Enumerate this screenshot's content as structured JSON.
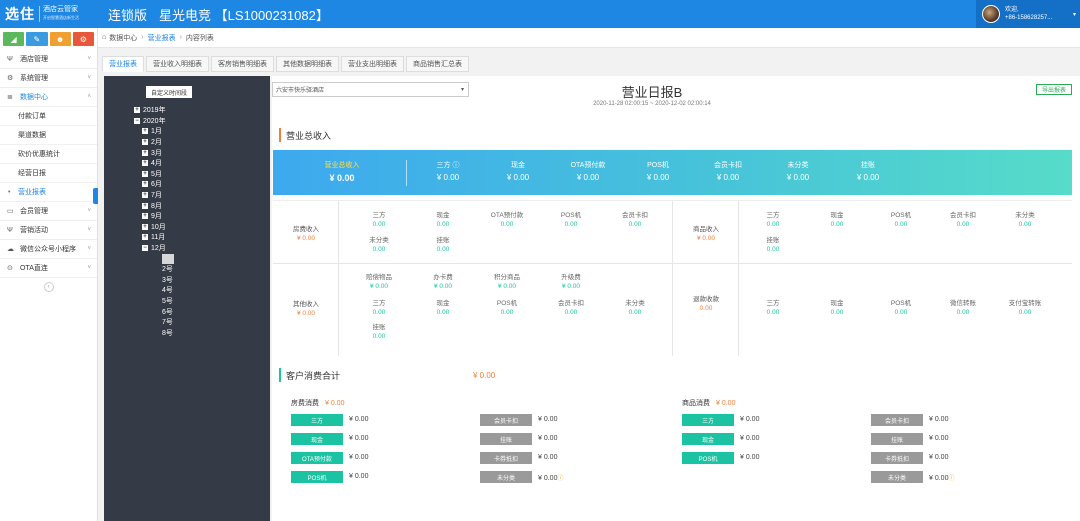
{
  "header": {
    "logo_main": "选住",
    "logo_sub1": "酒店云管家",
    "logo_sub2": "开启智慧酒店新生活",
    "edition": "连锁版",
    "store_name": "星光电竞 【LS1000231082】",
    "welcome": "欢迎,",
    "phone": "+86-158628257..."
  },
  "quick_buttons": [
    {
      "icon": "chart-icon",
      "color": "#5cb85c",
      "glyph": "◢"
    },
    {
      "icon": "pencil-icon",
      "color": "#3b9be0",
      "glyph": "✎"
    },
    {
      "icon": "users-icon",
      "color": "#f0a030",
      "glyph": "☻"
    },
    {
      "icon": "gear-icon",
      "color": "#e8573c",
      "glyph": "⚙"
    }
  ],
  "sidebar": {
    "items": [
      {
        "label": "酒店管理",
        "glyph": "Ψ"
      },
      {
        "label": "系统管理",
        "glyph": "⚙"
      },
      {
        "label": "数据中心",
        "glyph": "≣"
      }
    ],
    "sub_items": [
      {
        "label": "付款订单"
      },
      {
        "label": "渠道数据"
      },
      {
        "label": "砍价优惠统计"
      },
      {
        "label": "经营日报"
      },
      {
        "label": "营业报表"
      }
    ],
    "items_after": [
      {
        "label": "会员管理",
        "glyph": "▭"
      },
      {
        "label": "营销活动",
        "glyph": "Ψ"
      },
      {
        "label": "微信公众号小程序",
        "glyph": "☁"
      },
      {
        "label": "OTA直连",
        "glyph": "⊙"
      }
    ]
  },
  "breadcrumb": {
    "home": "数据中心",
    "section": "营业报表",
    "page": "内容列表"
  },
  "tabs": [
    "营业报表",
    "营业收入明细表",
    "客房销售明细表",
    "其他数据明细表",
    "营业支出明细表",
    "商品销售汇总表"
  ],
  "tree": {
    "button": "自定义时间段",
    "nodes": [
      {
        "label": "2019年",
        "box": "+",
        "level": 1
      },
      {
        "label": "2020年",
        "box": "−",
        "level": 1
      },
      {
        "label": "1月",
        "box": "+",
        "level": 2
      },
      {
        "label": "2月",
        "box": "+",
        "level": 2
      },
      {
        "label": "3月",
        "box": "+",
        "level": 2
      },
      {
        "label": "4月",
        "box": "+",
        "level": 2
      },
      {
        "label": "5月",
        "box": "+",
        "level": 2
      },
      {
        "label": "6月",
        "box": "+",
        "level": 2
      },
      {
        "label": "7月",
        "box": "+",
        "level": 2
      },
      {
        "label": "8月",
        "box": "+",
        "level": 2
      },
      {
        "label": "9月",
        "box": "+",
        "level": 2
      },
      {
        "label": "10月",
        "box": "+",
        "level": 2
      },
      {
        "label": "11月",
        "box": "+",
        "level": 2
      },
      {
        "label": "12月",
        "box": "−",
        "level": 2
      },
      {
        "label": "",
        "box": "",
        "level": 3,
        "selected": true
      },
      {
        "label": "2号",
        "box": "",
        "level": 3
      },
      {
        "label": "3号",
        "box": "",
        "level": 3
      },
      {
        "label": "4号",
        "box": "",
        "level": 3
      },
      {
        "label": "5号",
        "box": "",
        "level": 3
      },
      {
        "label": "6号",
        "box": "",
        "level": 3
      },
      {
        "label": "7号",
        "box": "",
        "level": 3
      },
      {
        "label": "8号",
        "box": "",
        "level": 3
      }
    ]
  },
  "report": {
    "store_select": "六安市快乐驿酒店",
    "title": "营业日报B",
    "range": "2020-11-28 02:00:15 ~ 2020-12-02 02:00:14",
    "export": "导出报表"
  },
  "revenue": {
    "section_title": "营业总收入",
    "summary": [
      {
        "label": "营业总收入",
        "value": "¥ 0.00"
      },
      {
        "label": "三方 ⓘ",
        "value": "¥ 0.00"
      },
      {
        "label": "现金",
        "value": "¥ 0.00"
      },
      {
        "label": "OTA预付款",
        "value": "¥ 0.00"
      },
      {
        "label": "POS机",
        "value": "¥ 0.00"
      },
      {
        "label": "会员卡扣",
        "value": "¥ 0.00"
      },
      {
        "label": "未分类",
        "value": "¥ 0.00"
      },
      {
        "label": "挂账",
        "value": "¥ 0.00"
      }
    ],
    "room": {
      "label": "房费收入",
      "amount": "¥ 0.00",
      "cells": [
        {
          "label": "三方",
          "value": "0.00"
        },
        {
          "label": "现金",
          "value": "0.00"
        },
        {
          "label": "OTA预付款",
          "value": "0.00"
        },
        {
          "label": "POS机",
          "value": "0.00"
        },
        {
          "label": "会员卡扣",
          "value": "0.00"
        },
        {
          "label": "未分类",
          "value": "0.00"
        },
        {
          "label": "挂账",
          "value": "0.00"
        }
      ]
    },
    "goods": {
      "label": "商品收入",
      "amount": "¥ 0.00",
      "cells": [
        {
          "label": "三方",
          "value": "0.00"
        },
        {
          "label": "现金",
          "value": "0.00"
        },
        {
          "label": "POS机",
          "value": "0.00"
        },
        {
          "label": "会员卡扣",
          "value": "0.00"
        },
        {
          "label": "未分类",
          "value": "0.00"
        },
        {
          "label": "挂账",
          "value": "0.00"
        }
      ]
    },
    "other": {
      "label": "其他收入",
      "amount": "¥ 0.00",
      "top": [
        {
          "label": "赔偿物品",
          "value": "¥ 0.00"
        },
        {
          "label": "办卡费",
          "value": "¥ 0.00"
        },
        {
          "label": "积分商品",
          "value": "¥ 0.00"
        },
        {
          "label": "升级费",
          "value": "¥ 0.00"
        }
      ],
      "cells": [
        {
          "label": "三方",
          "value": "0.00"
        },
        {
          "label": "现金",
          "value": "0.00"
        },
        {
          "label": "POS机",
          "value": "0.00"
        },
        {
          "label": "会员卡扣",
          "value": "0.00"
        },
        {
          "label": "未分类",
          "value": "0.00"
        },
        {
          "label": "挂账",
          "value": "0.00"
        }
      ]
    },
    "refund": {
      "label": "退款收款",
      "amount": "0.00",
      "cells": [
        {
          "label": "三方",
          "value": "0.00"
        },
        {
          "label": "现金",
          "value": "0.00"
        },
        {
          "label": "POS机",
          "value": "0.00"
        },
        {
          "label": "微信转账",
          "value": "0.00"
        },
        {
          "label": "支付宝转账",
          "value": "0.00"
        }
      ]
    }
  },
  "consumption": {
    "section_title": "客户消费合计",
    "total": "¥ 0.00",
    "room": {
      "title": "房费消费",
      "amount": "¥ 0.00",
      "left": [
        {
          "label": "三方",
          "value": "¥ 0.00"
        },
        {
          "label": "现金",
          "value": "¥ 0.00"
        },
        {
          "label": "OTA预付款",
          "value": "¥ 0.00"
        },
        {
          "label": "POS机",
          "value": "¥ 0.00"
        }
      ],
      "right": [
        {
          "label": "会员卡扣",
          "value": "¥ 0.00"
        },
        {
          "label": "挂账",
          "value": "¥ 0.00"
        },
        {
          "label": "卡券抵扣",
          "value": "¥ 0.00"
        },
        {
          "label": "未分类",
          "value": "¥ 0.00",
          "info": "ⓘ"
        }
      ]
    },
    "goods": {
      "title": "商品消费",
      "amount": "¥ 0.00",
      "left": [
        {
          "label": "三方",
          "value": "¥ 0.00"
        },
        {
          "label": "现金",
          "value": "¥ 0.00"
        },
        {
          "label": "POS机",
          "value": "¥ 0.00"
        }
      ],
      "right": [
        {
          "label": "会员卡扣",
          "value": "¥ 0.00"
        },
        {
          "label": "挂账",
          "value": "¥ 0.00"
        },
        {
          "label": "卡券抵扣",
          "value": "¥ 0.00"
        },
        {
          "label": "未分类",
          "value": "¥ 0.00",
          "info": "ⓘ"
        }
      ]
    }
  },
  "colors": {
    "brand": "#1e86e3",
    "accent_orange": "#f07f3c",
    "accent_green": "#1cc3a3",
    "tree_bg": "#343a46"
  }
}
